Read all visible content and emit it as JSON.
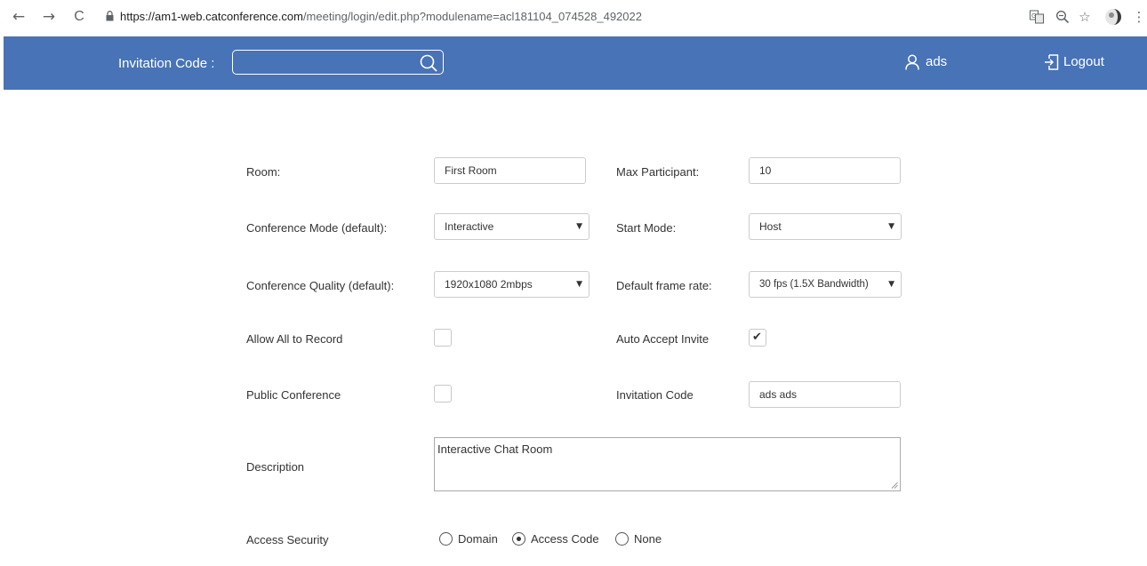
{
  "browser": {
    "back": "←",
    "forward": "→",
    "reload": "C",
    "url_host": "https://am1-web.catconference.com",
    "url_path": "/meeting/login/edit.php?modulename=acl181104_074528_492022",
    "zoom": "⊖",
    "star": "☆",
    "menu": "⋮"
  },
  "header": {
    "invitation_label": "Invitation Code :",
    "invitation_value": "",
    "user": "ads",
    "logout": "Logout"
  },
  "form": {
    "room": {
      "label": "Room:",
      "value": "First Room"
    },
    "max_participant": {
      "label": "Max Participant:",
      "value": "10"
    },
    "conference_mode": {
      "label": "Conference Mode (default):",
      "value": "Interactive"
    },
    "start_mode": {
      "label": "Start Mode:",
      "value": "Host"
    },
    "conference_quality": {
      "label": "Conference Quality (default):",
      "value": "1920x1080 2mbps"
    },
    "frame_rate": {
      "label": "Default frame rate:",
      "value": "30 fps (1.5X Bandwidth)"
    },
    "allow_record": {
      "label": "Allow All to Record",
      "checked": false
    },
    "auto_accept": {
      "label": "Auto Accept Invite",
      "checked": true
    },
    "public_conference": {
      "label": "Public Conference",
      "checked": false
    },
    "invitation_code": {
      "label": "Invitation Code",
      "value": "ads ads"
    },
    "description": {
      "label": "Description",
      "value": "Interactive Chat Room"
    },
    "access_security": {
      "label": "Access Security",
      "options": [
        "Domain",
        "Access Code",
        "None"
      ],
      "selected": "Access Code"
    }
  },
  "colors": {
    "header": "#4873b6",
    "text": "#333333"
  }
}
